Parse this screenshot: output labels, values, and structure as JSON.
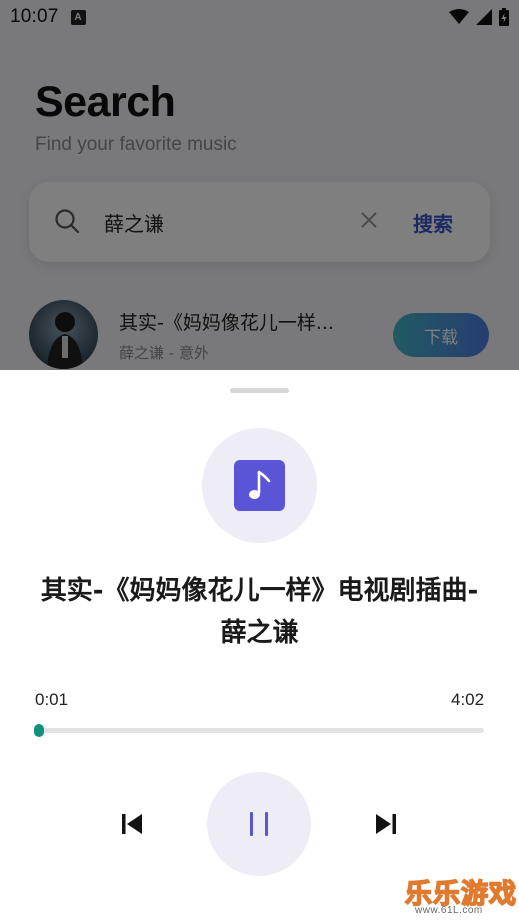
{
  "status_bar": {
    "time": "10:07",
    "notification_badge": "A",
    "icons": [
      "wifi-icon",
      "signal-icon",
      "battery-icon"
    ]
  },
  "search_screen": {
    "title": "Search",
    "subtitle": "Find your favorite music",
    "search": {
      "value": "薛之谦",
      "button_label": "搜索"
    },
    "results": [
      {
        "title": "其实-《妈妈像花儿一样...",
        "subtitle": "薛之谦 - 意外",
        "action_label": "下载"
      }
    ]
  },
  "player": {
    "song_title": "其实-《妈妈像花儿一样》电视剧插曲-薛之谦",
    "current_time": "0:01",
    "total_time": "4:02",
    "progress": 0.004,
    "state": "playing"
  },
  "watermark": {
    "text": "乐乐游戏",
    "url": "www.61L.com"
  },
  "colors": {
    "accent_purple": "#5a55d6",
    "accent_teal": "#1aa890",
    "search_button": "#3a52c9",
    "sheet_background": "#ffffff",
    "overlay": "rgba(0,0,0,0.5)"
  }
}
